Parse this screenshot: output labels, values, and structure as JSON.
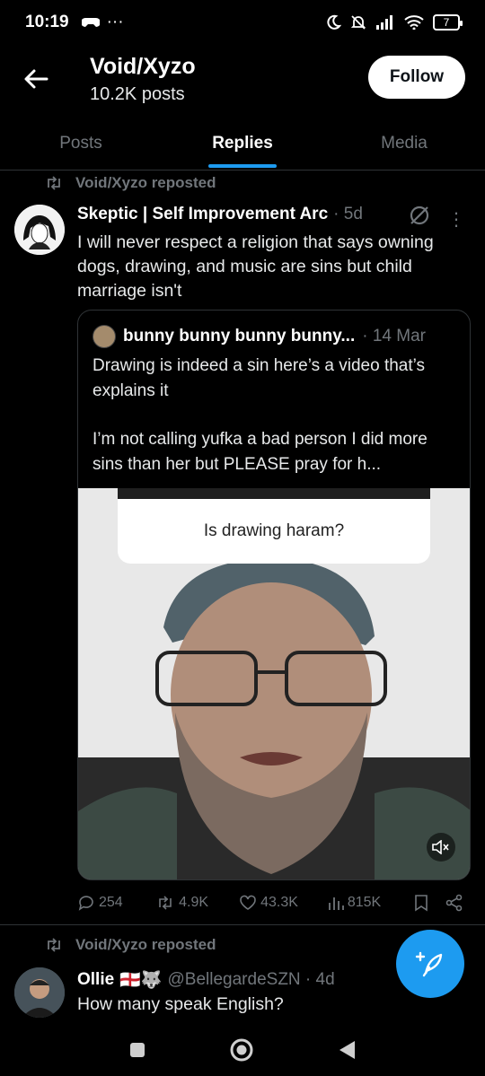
{
  "status_bar": {
    "time": "10:19",
    "battery": "7"
  },
  "header": {
    "title": "Void/Xyzo",
    "subtitle": "10.2K posts",
    "follow_label": "Follow"
  },
  "tabs": [
    {
      "label": "Posts",
      "active": false
    },
    {
      "label": "Replies",
      "active": true
    },
    {
      "label": "Media",
      "active": false
    }
  ],
  "post1": {
    "repost_label": "Void/Xyzo reposted",
    "author": "Skeptic | Self Improvement Arc",
    "meta": "· 5d",
    "text": "I will never respect a religion that says owning dogs, drawing, and music are sins but child marriage isn't",
    "quote": {
      "author": "bunny bunny bunny bunny...",
      "meta": "· 14 Mar",
      "text_line1": "Drawing is indeed a sin here’s a video that’s explains it",
      "text_line2": "I’m not calling yufka a bad person I did more sins than her but PLEASE pray for h...",
      "video_caption": "Is drawing haram?"
    },
    "stats": {
      "replies": "254",
      "reposts": "4.9K",
      "likes": "43.3K",
      "views": "815K"
    }
  },
  "post2": {
    "repost_label": "Void/Xyzo reposted",
    "author": "Ollie",
    "flags": "🏴󠁧󠁢󠁥󠁮󠁧󠁿🐺",
    "handle": "@BellegardeSZN · 4d",
    "text": "How many speak English?"
  },
  "colors": {
    "accent": "#1d9bf0",
    "background": "#000000",
    "muted": "#71767b"
  }
}
